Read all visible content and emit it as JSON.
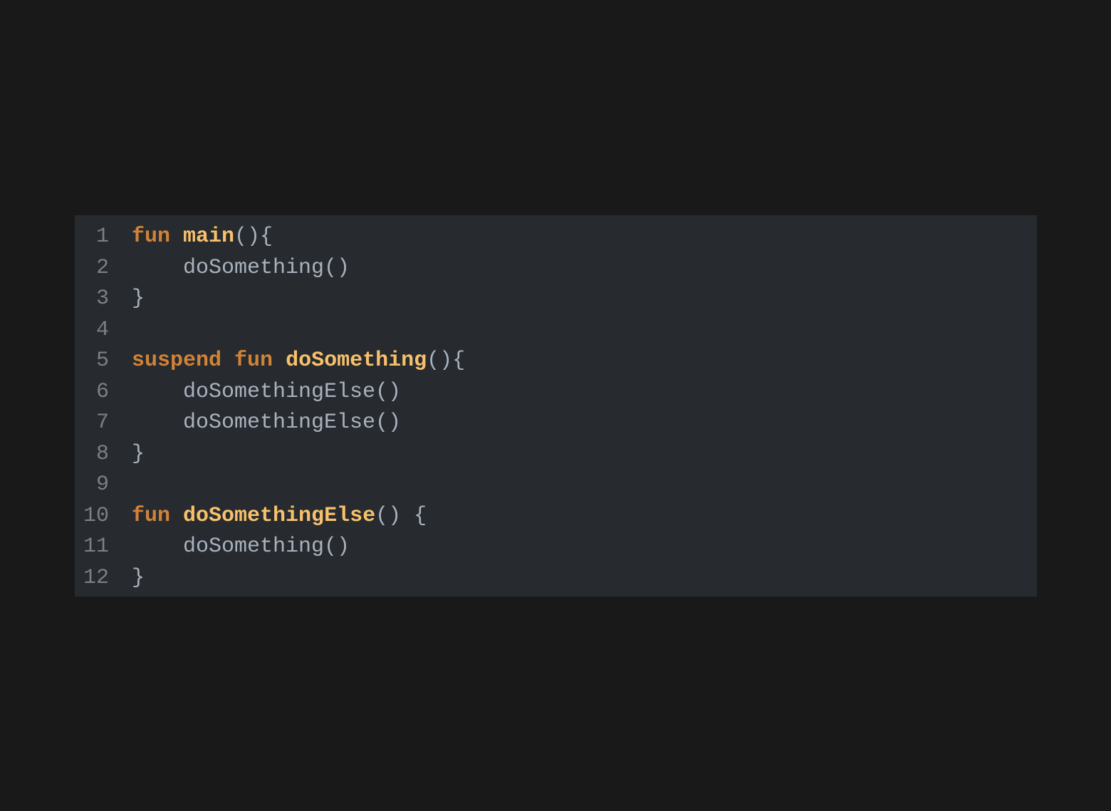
{
  "colors": {
    "page_background": "#191919",
    "panel_background": "#272a2e",
    "line_number": "#7b8087",
    "keyword": "#d08338",
    "function_name": "#f7c16c",
    "plain_text": "#a8b2bf"
  },
  "code": {
    "lines": [
      {
        "number": "1",
        "tokens": [
          {
            "type": "keyword",
            "text": "fun"
          },
          {
            "type": "text",
            "text": " "
          },
          {
            "type": "fn",
            "text": "main"
          },
          {
            "type": "punct",
            "text": "(){"
          }
        ]
      },
      {
        "number": "2",
        "tokens": [
          {
            "type": "text",
            "text": "    doSomething()"
          }
        ]
      },
      {
        "number": "3",
        "tokens": [
          {
            "type": "punct",
            "text": "}"
          }
        ]
      },
      {
        "number": "4",
        "tokens": []
      },
      {
        "number": "5",
        "tokens": [
          {
            "type": "keyword",
            "text": "suspend"
          },
          {
            "type": "text",
            "text": " "
          },
          {
            "type": "keyword",
            "text": "fun"
          },
          {
            "type": "text",
            "text": " "
          },
          {
            "type": "fn",
            "text": "doSomething"
          },
          {
            "type": "punct",
            "text": "(){"
          }
        ]
      },
      {
        "number": "6",
        "tokens": [
          {
            "type": "text",
            "text": "    doSomethingElse()"
          }
        ]
      },
      {
        "number": "7",
        "tokens": [
          {
            "type": "text",
            "text": "    doSomethingElse()"
          }
        ]
      },
      {
        "number": "8",
        "tokens": [
          {
            "type": "punct",
            "text": "}"
          }
        ]
      },
      {
        "number": "9",
        "tokens": []
      },
      {
        "number": "10",
        "tokens": [
          {
            "type": "keyword",
            "text": "fun"
          },
          {
            "type": "text",
            "text": " "
          },
          {
            "type": "fn",
            "text": "doSomethingElse"
          },
          {
            "type": "punct",
            "text": "() {"
          }
        ]
      },
      {
        "number": "11",
        "tokens": [
          {
            "type": "text",
            "text": "    doSomething()"
          }
        ]
      },
      {
        "number": "12",
        "tokens": [
          {
            "type": "punct",
            "text": "}"
          }
        ]
      }
    ]
  }
}
